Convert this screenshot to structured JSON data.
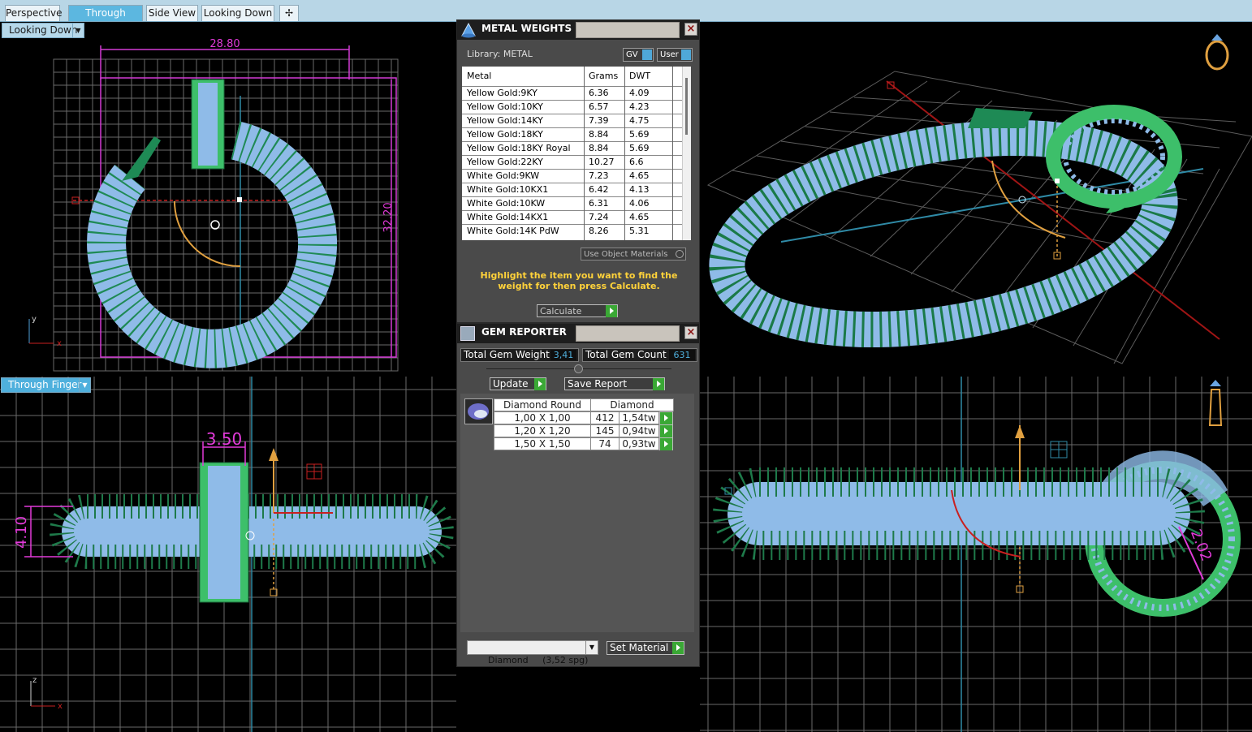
{
  "tabs": [
    "Perspective",
    "Through Finger",
    "Side View",
    "Looking Down"
  ],
  "viewports": {
    "top_left": {
      "dropdown": "Looking Down",
      "dim_width": "28.80",
      "dim_height": "32.20"
    },
    "bottom_left": {
      "dropdown": "Through Finger",
      "dim_a": "3.50",
      "dim_b": "4.10"
    },
    "bottom_right": {
      "dim": "2.02"
    }
  },
  "metal_weights": {
    "title": "METAL WEIGHTS",
    "library": "Library: METAL",
    "toggle_gv": "GV",
    "toggle_user": "User",
    "columns": [
      "Metal",
      "Grams",
      "DWT"
    ],
    "rows": [
      [
        "Yellow Gold:9KY",
        "6.36",
        "4.09"
      ],
      [
        "Yellow Gold:10KY",
        "6.57",
        "4.23"
      ],
      [
        "Yellow Gold:14KY",
        "7.39",
        "4.75"
      ],
      [
        "Yellow Gold:18KY",
        "8.84",
        "5.69"
      ],
      [
        "Yellow Gold:18KY Royal",
        "8.84",
        "5.69"
      ],
      [
        "Yellow Gold:22KY",
        "10.27",
        "6.6"
      ],
      [
        "White Gold:9KW",
        "7.23",
        "4.65"
      ],
      [
        "White Gold:10KX1",
        "6.42",
        "4.13"
      ],
      [
        "White Gold:10KW",
        "6.31",
        "4.06"
      ],
      [
        "White Gold:14KX1",
        "7.24",
        "4.65"
      ],
      [
        "White Gold:14K PdW",
        "8.26",
        "5.31"
      ]
    ],
    "use_object_materials": "Use Object Materials",
    "hint": "Highlight the item you want to find the weight for then press Calculate.",
    "calculate": "Calculate"
  },
  "gem_reporter": {
    "title": "GEM REPORTER",
    "total_weight_label": "Total Gem Weight",
    "total_weight_value": "3,41",
    "total_count_label": "Total Gem Count",
    "total_count_value": "631",
    "update": "Update",
    "save_report": "Save Report",
    "header_cut": "Diamond Round",
    "header_material": "Diamond",
    "rows": [
      [
        "1,00 X 1,00",
        "412",
        "1,54tw"
      ],
      [
        "1,20 X 1,20",
        "145",
        "0,94tw"
      ],
      [
        "1,50 X 1,50",
        "74",
        "0,93tw"
      ]
    ],
    "material_select": "Diamond     (3,52 spg)",
    "set_material": "Set Material"
  },
  "colors": {
    "ring": "#7fb3e8",
    "band": "#3dbf6a",
    "gem_green": "#1e7a4a",
    "dimension": "#e23ad9",
    "accent_tab": "#5cb7e0"
  }
}
